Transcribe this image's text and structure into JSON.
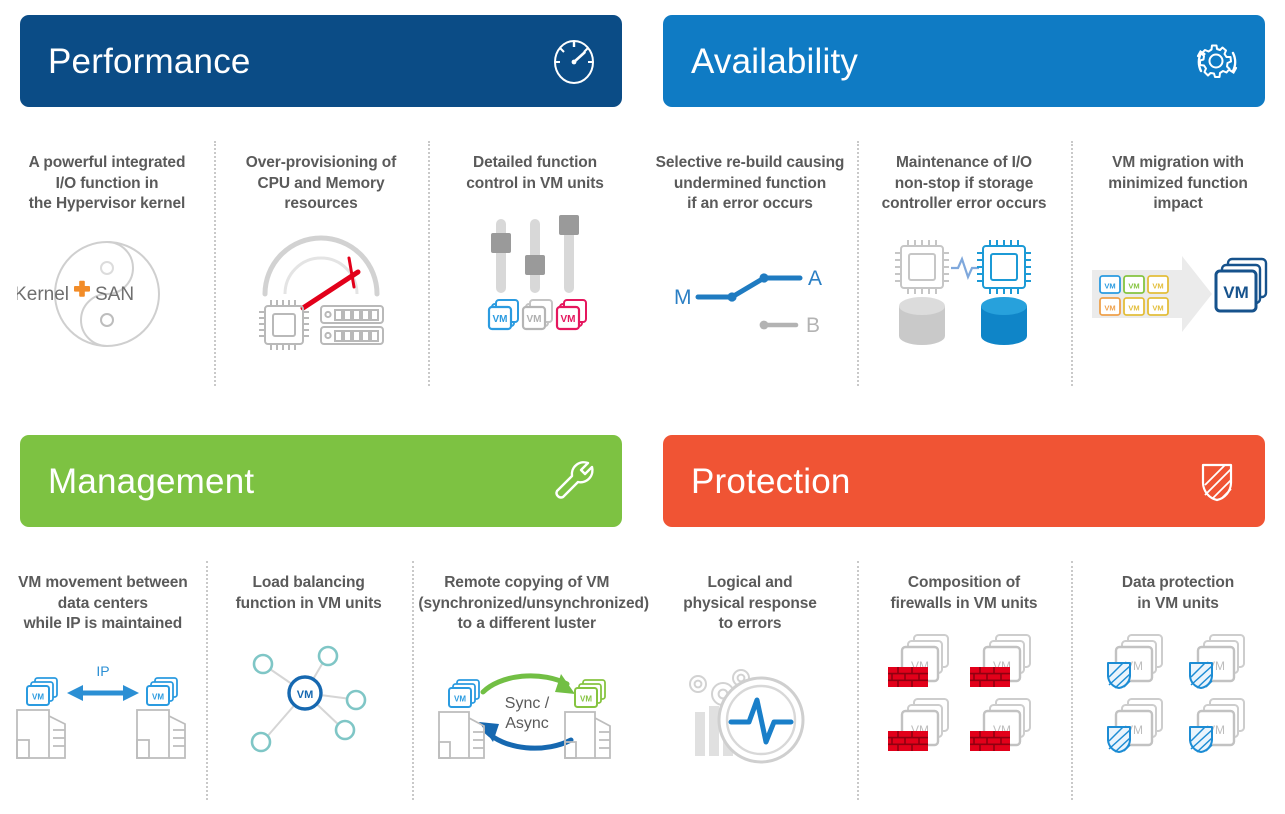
{
  "panels": [
    {
      "id": "performance",
      "title": "Performance",
      "color": "#0B4C86",
      "icon": "speedometer-icon",
      "cells": [
        {
          "text": "A powerful integrated\nI/O function in\nthe Hypervisor kernel",
          "art": "kernel-san-circle",
          "labels": {
            "left": "Kernel",
            "right": "SAN"
          }
        },
        {
          "text": "Over-provisioning of\nCPU and Memory\nresources",
          "art": "gauge-cpu-memory",
          "labels": {}
        },
        {
          "text": "Detailed function\ncontrol in VM units",
          "art": "sliders-vm",
          "labels": {
            "vm": "VM"
          }
        }
      ]
    },
    {
      "id": "availability",
      "title": "Availability",
      "color": "#0F7BC4",
      "icon": "gear-refresh-icon",
      "cells": [
        {
          "text": "Selective re-build causing\nundermined function\nif an error occurs",
          "art": "switch-m-a-b",
          "labels": {
            "m": "M",
            "a": "A",
            "b": "B"
          }
        },
        {
          "text": "Maintenance of I/O\nnon-stop if storage\ncontroller error occurs",
          "art": "dual-controllers",
          "labels": {}
        },
        {
          "text": "VM migration with\nminimized function\nimpact",
          "art": "vm-migration-arrow",
          "labels": {
            "vm": "VM"
          }
        }
      ]
    },
    {
      "id": "management",
      "title": "Management",
      "color": "#7DC242",
      "icon": "wrench-icon",
      "cells": [
        {
          "text": "VM movement between\ndata centers\nwhile IP is maintained",
          "art": "datacenter-ip-move",
          "labels": {
            "ip": "IP",
            "vm": "VM"
          }
        },
        {
          "text": "Load balancing\nfunction in VM units",
          "art": "load-balance-hub",
          "labels": {
            "vm": "VM"
          }
        },
        {
          "text": "Remote copying of VM\n(synchronized/unsynchronized)\nto a different luster",
          "art": "sync-async-copy",
          "labels": {
            "line1": "Sync /",
            "line2": "Async",
            "vm": "VM"
          }
        }
      ]
    },
    {
      "id": "protection",
      "title": "Protection",
      "color": "#F05434",
      "icon": "shield-striped-icon",
      "cells": [
        {
          "text": "Logical and\nphysical response\nto errors",
          "art": "pulse-gears",
          "labels": {}
        },
        {
          "text": "Composition of\nfirewalls in VM units",
          "art": "vm-firewalls",
          "labels": {
            "vm": "VM"
          }
        },
        {
          "text": "Data protection\nin VM units",
          "art": "vm-shields",
          "labels": {
            "vm": "VM"
          }
        }
      ]
    }
  ],
  "palette": {
    "performance_blue": "#0B4C86",
    "availability_blue": "#0F7BC4",
    "management_green": "#7DC242",
    "protection_orange": "#F05434",
    "text_gray": "#5a5a5a",
    "accent_orange": "#F28C28",
    "accent_red": "#E2001A",
    "accent_teal": "#7FC6C6",
    "vm_blue": "#2B9BE0",
    "vm_pink": "#E5175E",
    "vm_green": "#86C440",
    "divider_gray": "#c9c9c9"
  }
}
